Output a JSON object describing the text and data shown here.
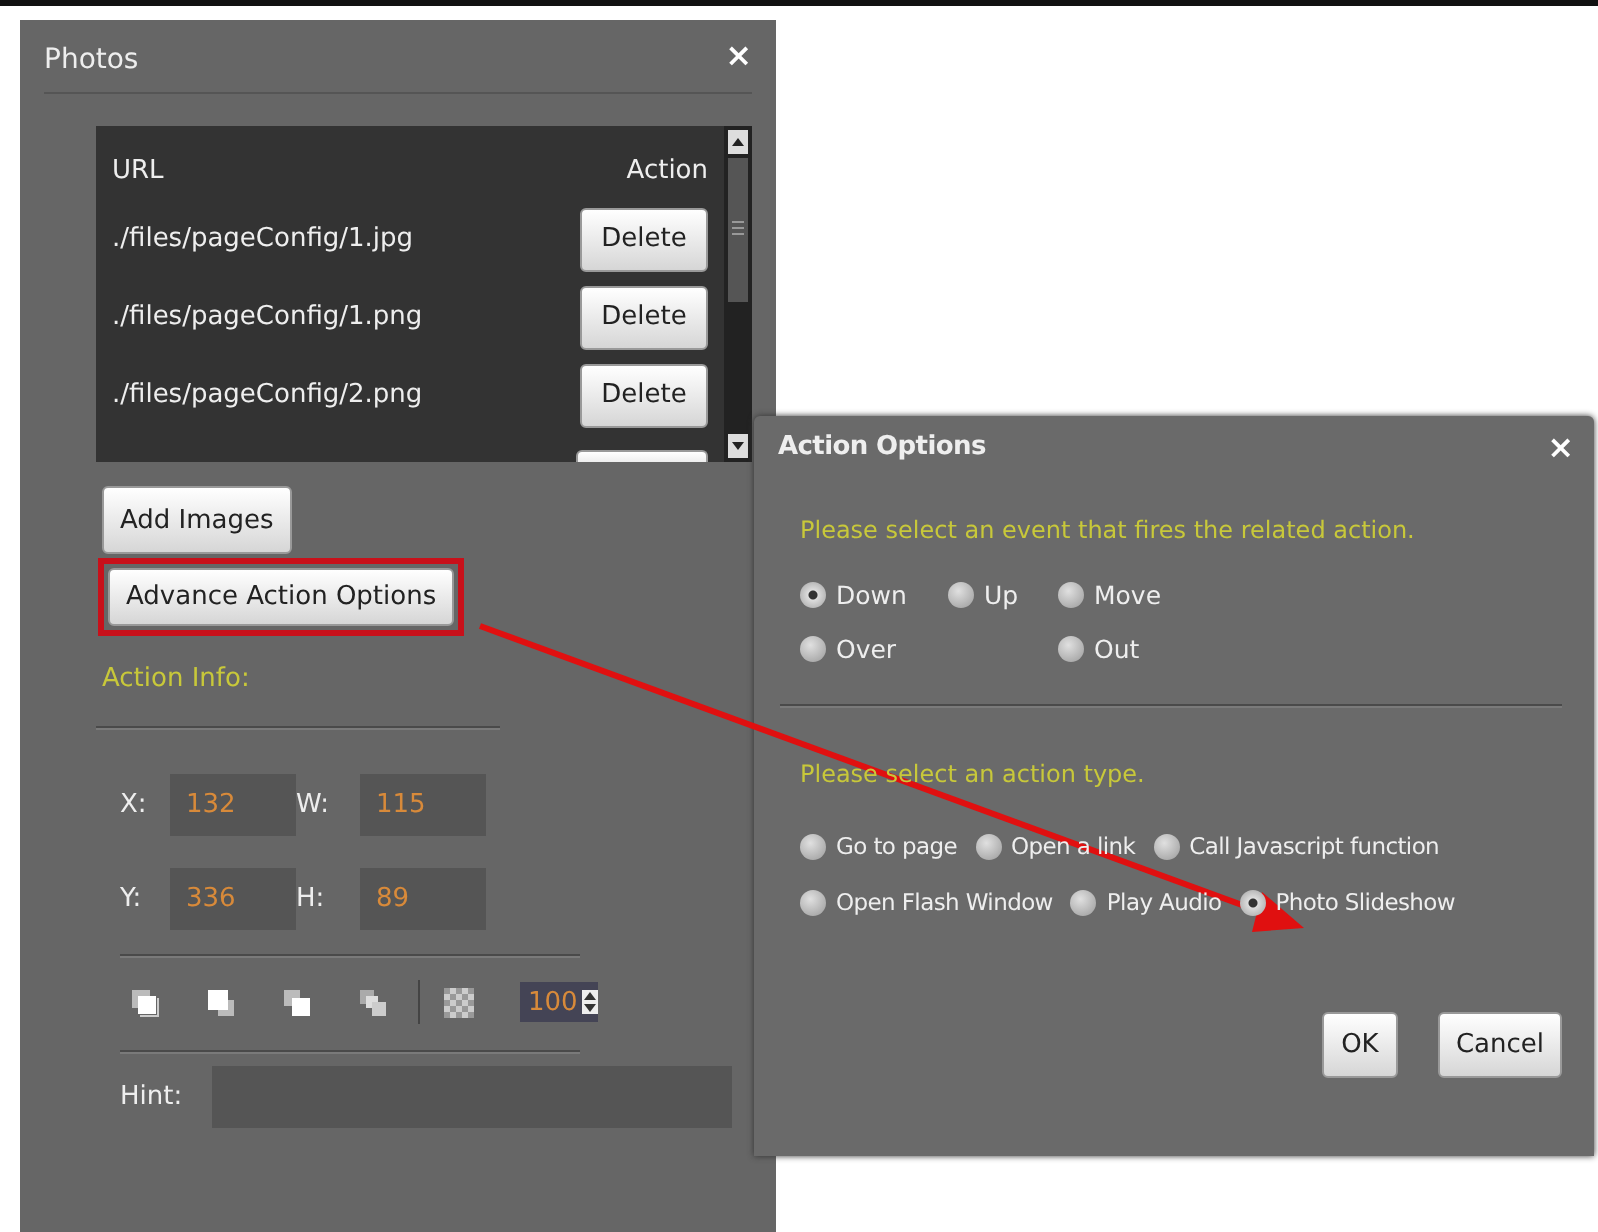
{
  "photos_panel": {
    "title": "Photos",
    "close": "×",
    "table": {
      "columns": [
        "URL",
        "Action"
      ],
      "rows": [
        {
          "url": "./files/pageConfig/1.jpg",
          "action": "Delete"
        },
        {
          "url": "./files/pageConfig/1.png",
          "action": "Delete"
        },
        {
          "url": "./files/pageConfig/2.png",
          "action": "Delete"
        }
      ]
    },
    "add_button": "Add Images",
    "advance_button": "Advance Action Options",
    "action_info_label": "Action Info:",
    "fields": [
      {
        "label": "X:",
        "value": "132"
      },
      {
        "label": "W:",
        "value": "115"
      },
      {
        "label": "Y:",
        "value": "336"
      },
      {
        "label": "H:",
        "value": "89"
      }
    ],
    "opacity": "100",
    "hint_label": "Hint:"
  },
  "action_options_dialog": {
    "title": "Action Options",
    "close": "×",
    "event_prompt": "Please select an event that fires the related action.",
    "events": [
      [
        {
          "label": "Down",
          "selected": true
        },
        {
          "label": "Up",
          "selected": false
        },
        {
          "label": "Move",
          "selected": false
        }
      ],
      [
        {
          "label": "Over",
          "selected": false
        },
        {
          "label": "Out",
          "selected": false
        }
      ]
    ],
    "action_prompt": "Please select an action type.",
    "action_types": [
      [
        {
          "label": "Go to page",
          "selected": false
        },
        {
          "label": "Open a link",
          "selected": false
        },
        {
          "label": "Call Javascript function",
          "selected": false
        }
      ],
      [
        {
          "label": "Open Flash Window",
          "selected": false
        },
        {
          "label": "Play Audio",
          "selected": false
        },
        {
          "label": "Photo Slideshow",
          "selected": true
        }
      ]
    ],
    "buttons": [
      "OK",
      "Cancel"
    ]
  }
}
